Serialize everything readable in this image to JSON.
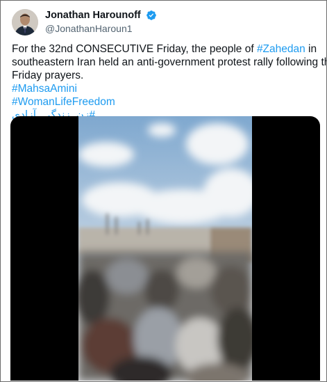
{
  "tweet": {
    "author": {
      "display_name": "Jonathan Harounoff",
      "handle": "@JonathanHaroun1",
      "verified_icon": "verified-badge-icon",
      "avatar_icon": "avatar"
    },
    "text": {
      "line1_pre": "For the 32nd CONSECUTIVE Friday, the people of ",
      "line1_hashtag": "#Zahedan",
      "line1_post": " in",
      "line2": "southeastern Iran held an anti-government protest rally following their",
      "line3": "Friday prayers."
    },
    "hashtags": [
      "#MahsaAmini",
      "#WomanLifeFreedom",
      "#زن_زندگی_آزادی"
    ],
    "media": {
      "type": "video",
      "icon": "video-thumbnail"
    }
  },
  "colors": {
    "link": "#1d9bf0",
    "text": "#0f1419",
    "secondary": "#536471",
    "verified": "#1d9bf0",
    "letterbox": "#000000"
  }
}
